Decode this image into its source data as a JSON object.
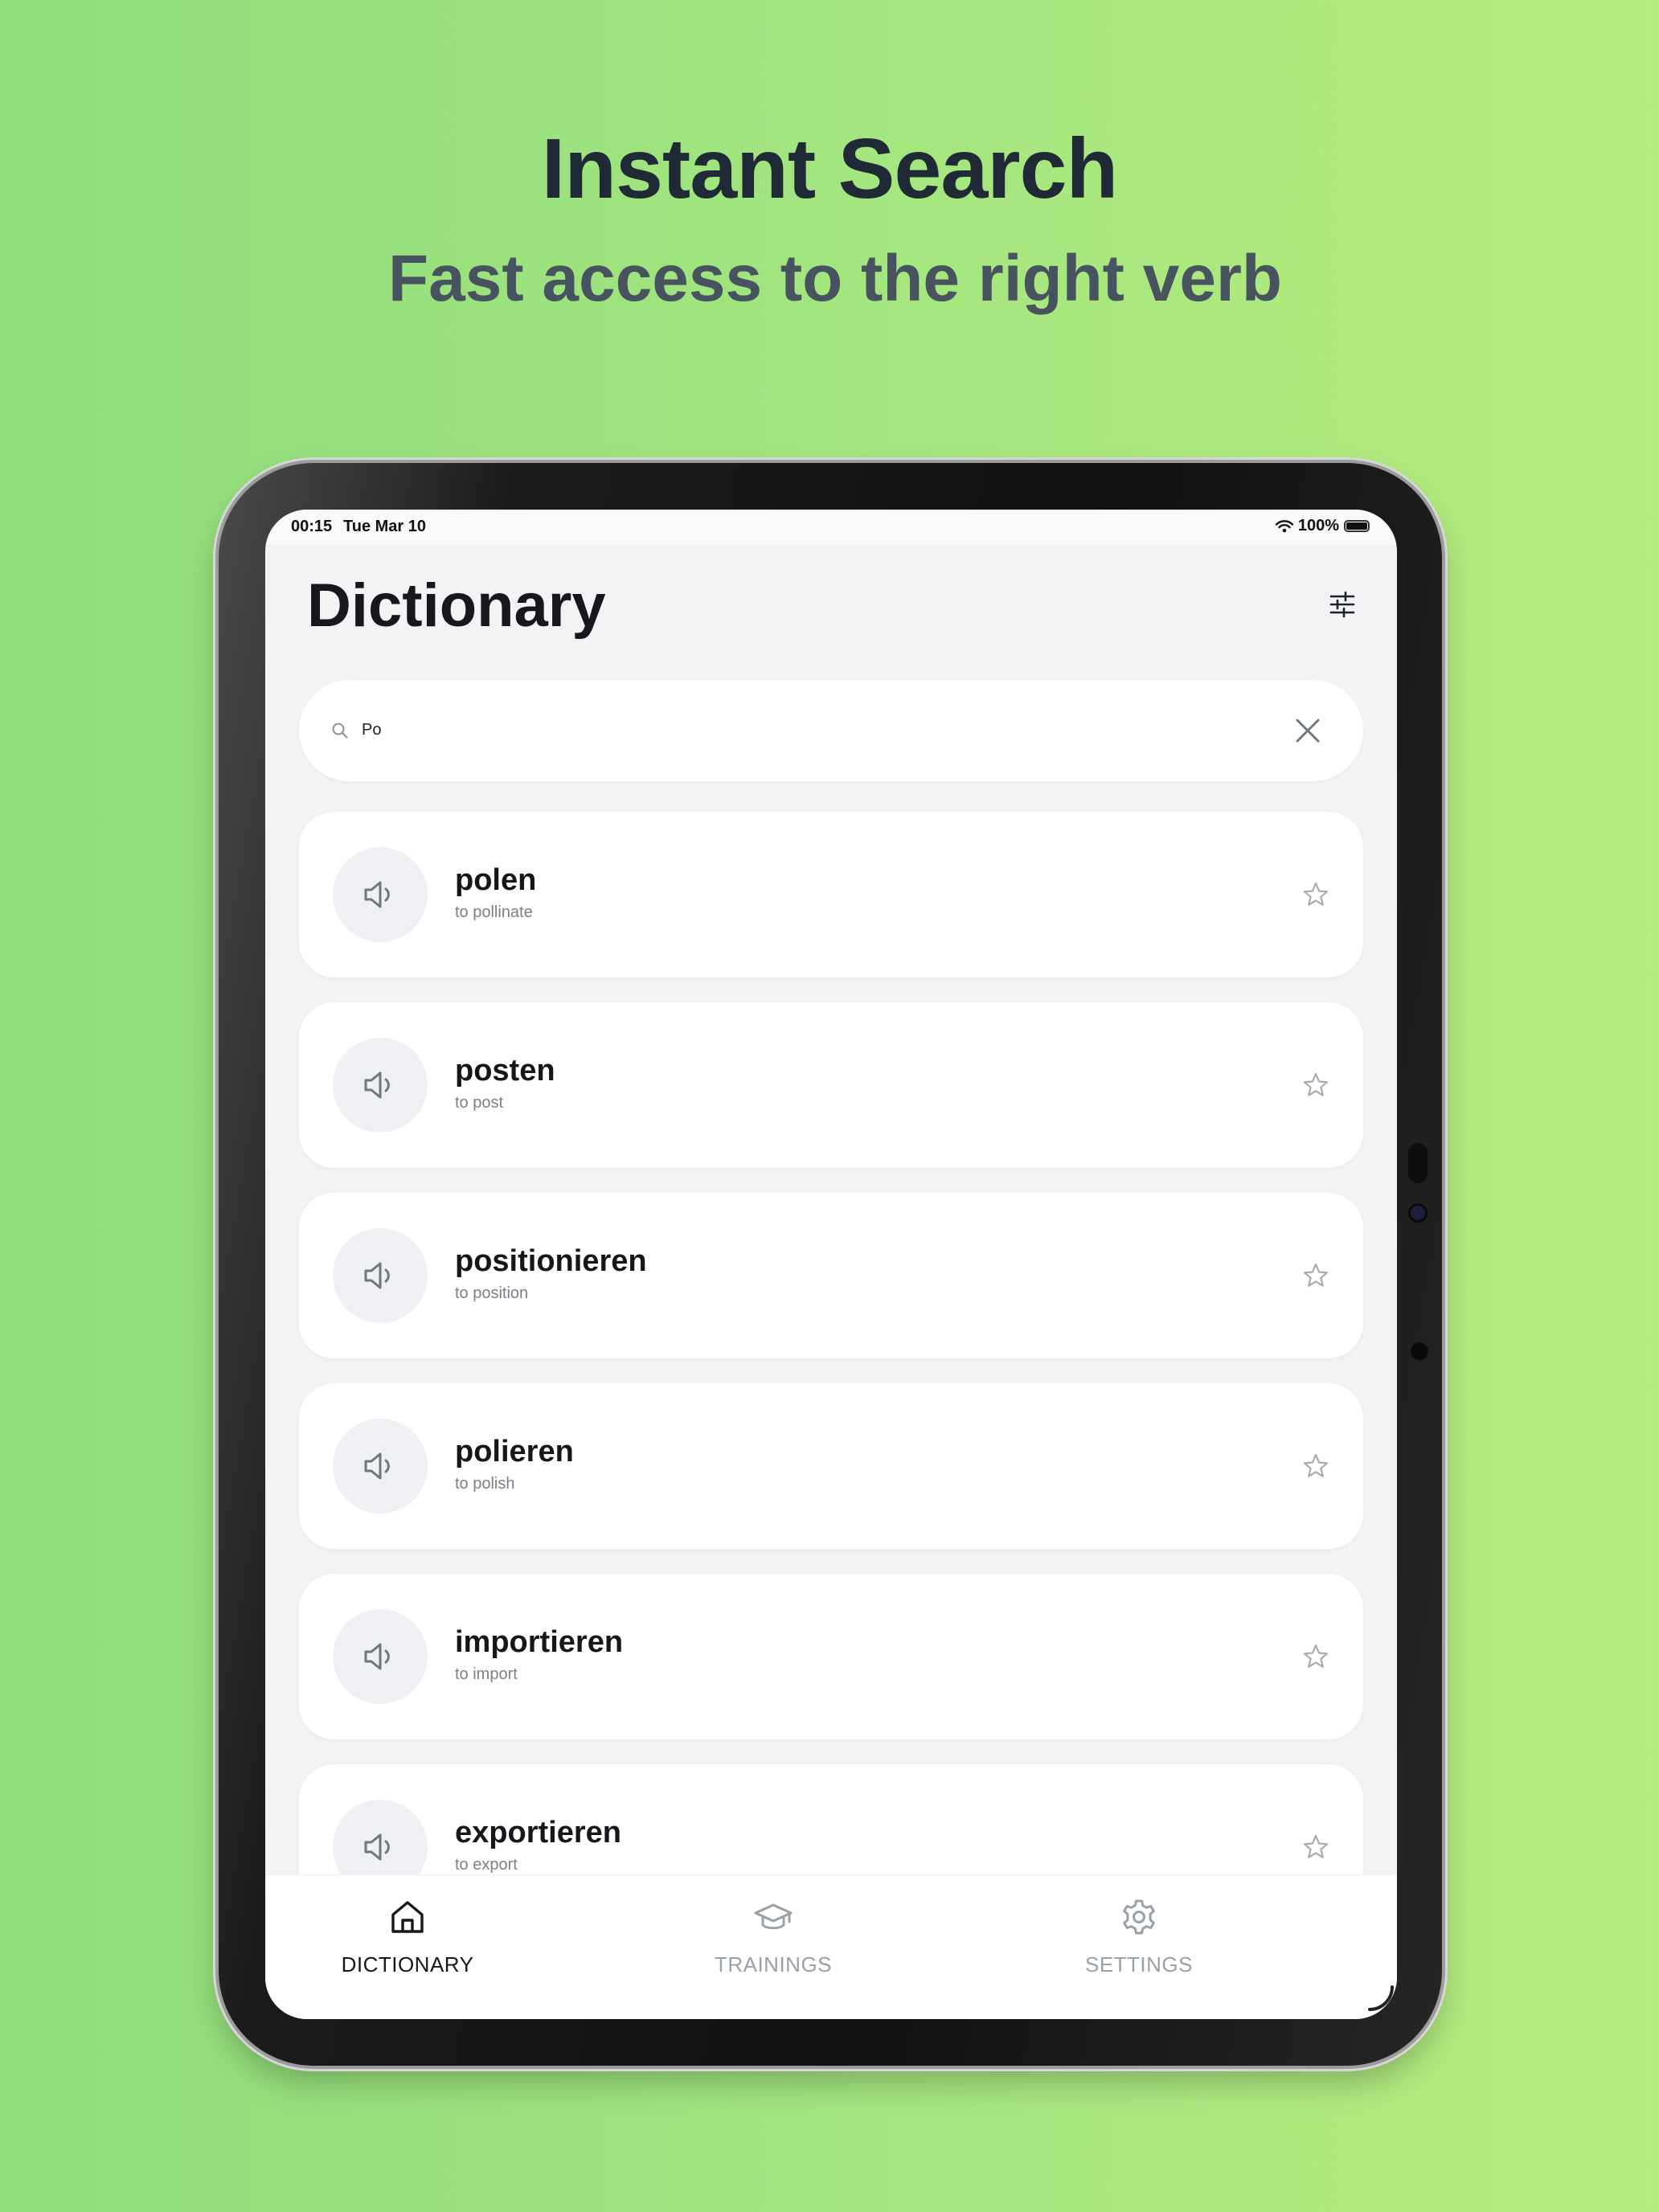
{
  "promo": {
    "headline": "Instant Search",
    "subheadline": "Fast access to the right verb"
  },
  "status_bar": {
    "time": "00:15",
    "date": "Tue Mar 10",
    "battery": "100%"
  },
  "page": {
    "title": "Dictionary"
  },
  "search": {
    "value": "Po",
    "placeholder": ""
  },
  "results": [
    {
      "word": "polen",
      "translation": "to pollinate"
    },
    {
      "word": "posten",
      "translation": "to post"
    },
    {
      "word": "positionieren",
      "translation": "to position"
    },
    {
      "word": "polieren",
      "translation": "to polish"
    },
    {
      "word": "importieren",
      "translation": "to import"
    },
    {
      "word": "exportieren",
      "translation": "to export"
    }
  ],
  "tabs": [
    {
      "label": "DICTIONARY",
      "icon": "home-icon",
      "active": true
    },
    {
      "label": "TRAININGS",
      "icon": "graduation-cap-icon",
      "active": false
    },
    {
      "label": "SETTINGS",
      "icon": "gear-icon",
      "active": false
    }
  ],
  "colors": {
    "active_tab": "#16181c",
    "inactive_tab": "#9aa0a8",
    "accent_background": "#a3e57f"
  }
}
